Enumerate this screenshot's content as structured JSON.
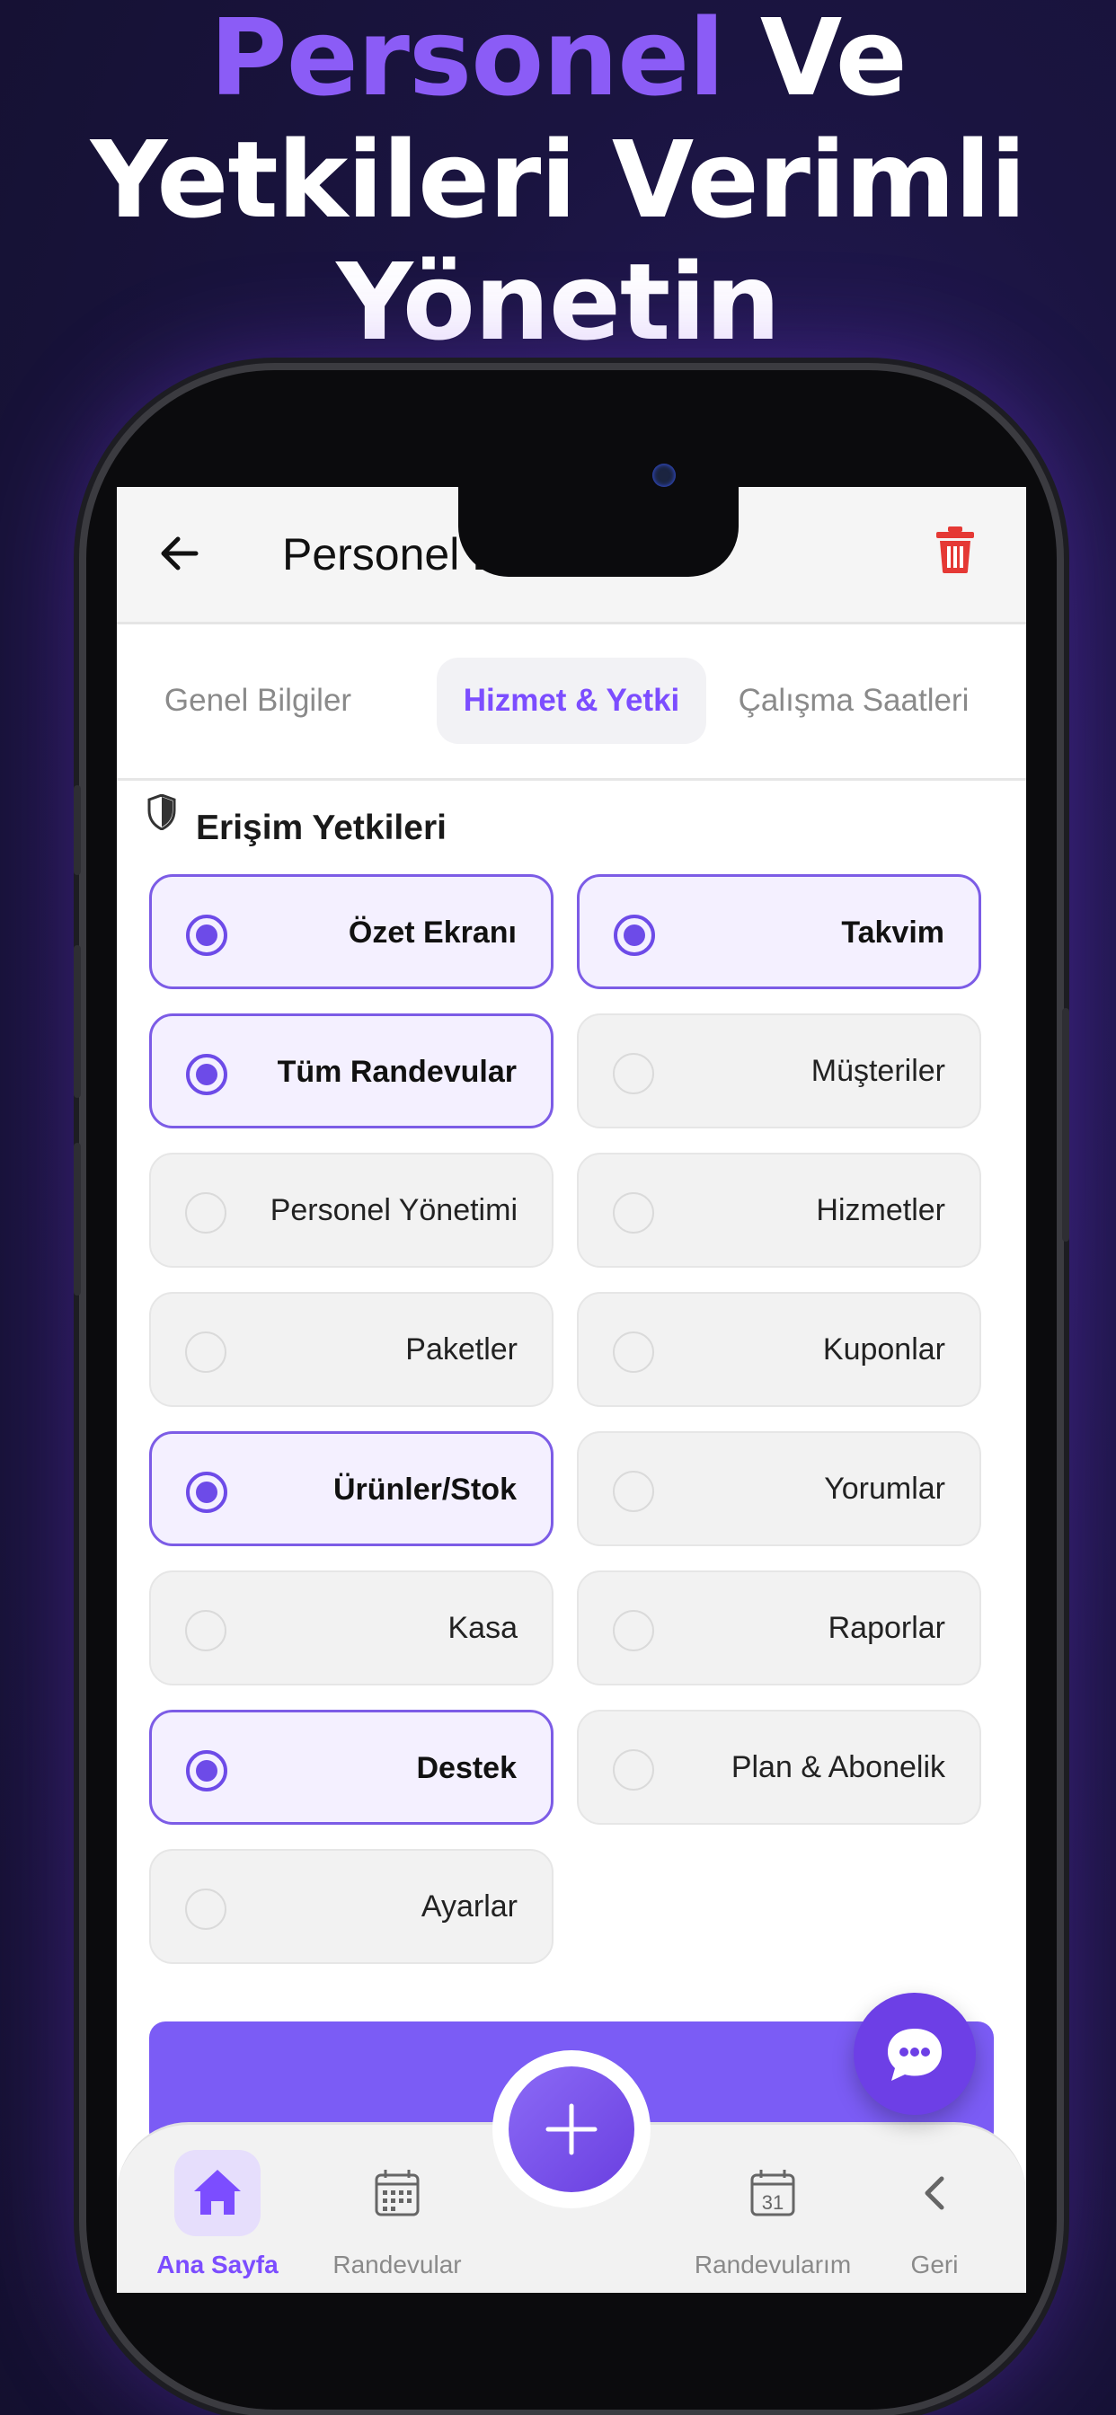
{
  "headline": {
    "accent": "Personel",
    "rest1": " Ve",
    "line2": "Yetkileri Verimli",
    "line3": "Yönetin"
  },
  "colors": {
    "accent": "#7c4dff",
    "background": "#1a1440",
    "danger": "#e53935"
  },
  "header": {
    "title": "Personel Düzenle",
    "back_icon": "arrow-left-icon",
    "delete_icon": "trash-icon"
  },
  "tabs": [
    {
      "label": "Genel Bilgiler",
      "active": false
    },
    {
      "label": "Hizmet & Yetki",
      "active": true
    },
    {
      "label": "Çalışma Saatleri",
      "active": false
    }
  ],
  "section": {
    "title": "Erişim Yetkileri",
    "icon": "shield-icon"
  },
  "permissions": [
    {
      "label": "Özet Ekranı",
      "checked": true
    },
    {
      "label": "Takvim",
      "checked": true
    },
    {
      "label": "Tüm Randevular",
      "checked": true
    },
    {
      "label": "Müşteriler",
      "checked": false
    },
    {
      "label": "Personel Yönetimi",
      "checked": false
    },
    {
      "label": "Hizmetler",
      "checked": false
    },
    {
      "label": "Paketler",
      "checked": false
    },
    {
      "label": "Kuponlar",
      "checked": false
    },
    {
      "label": "Ürünler/Stok",
      "checked": true
    },
    {
      "label": "Yorumlar",
      "checked": false
    },
    {
      "label": "Kasa",
      "checked": false
    },
    {
      "label": "Raporlar",
      "checked": false
    },
    {
      "label": "Destek",
      "checked": true
    },
    {
      "label": "Plan & Abonelik",
      "checked": false
    },
    {
      "label": "Ayarlar",
      "checked": false
    }
  ],
  "bottom_nav": [
    {
      "label": "Ana Sayfa",
      "icon": "home-icon",
      "active": true
    },
    {
      "label": "Randevular",
      "icon": "calendar-grid-icon",
      "active": false
    },
    {
      "label": "Randevularım",
      "icon": "calendar-31-icon",
      "active": false
    },
    {
      "label": "Geri",
      "icon": "chevron-left-icon",
      "active": false
    }
  ],
  "calendar_day": "31"
}
